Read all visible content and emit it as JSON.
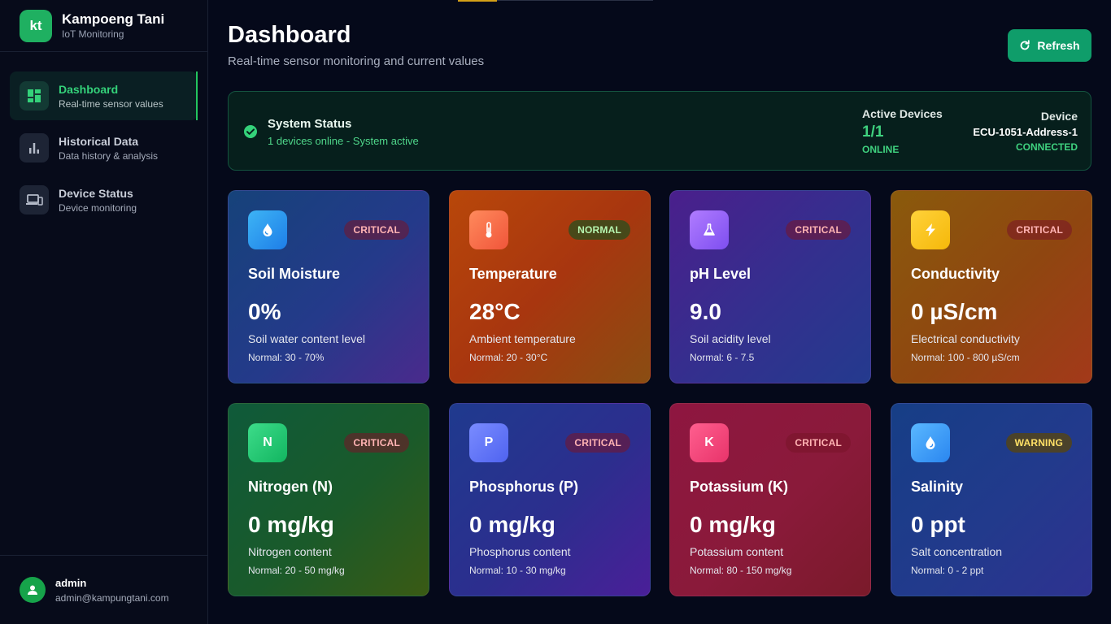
{
  "brand": {
    "logo_text": "kt",
    "title": "Kampoeng Tani",
    "subtitle": "IoT Monitoring"
  },
  "nav": [
    {
      "label": "Dashboard",
      "desc": "Real-time sensor values",
      "icon": "dashboard-grid-icon",
      "active": true
    },
    {
      "label": "Historical Data",
      "desc": "Data history & analysis",
      "icon": "bar-chart-icon",
      "active": false
    },
    {
      "label": "Device Status",
      "desc": "Device monitoring",
      "icon": "devices-icon",
      "active": false
    }
  ],
  "user": {
    "name": "admin",
    "email": "admin@kampungtani.com"
  },
  "page": {
    "title": "Dashboard",
    "subtitle": "Real-time sensor monitoring and current values",
    "refresh_label": "Refresh"
  },
  "status": {
    "title": "System Status",
    "subtitle": "1 devices online - System active",
    "active_label": "Active Devices",
    "active_value": "1/1",
    "active_state": "ONLINE",
    "device_label": "Device",
    "device_name": "ECU-1051-Address-1",
    "device_state": "CONNECTED"
  },
  "sensors": [
    {
      "name": "Soil Moisture",
      "value": "0%",
      "desc": "Soil water content level",
      "range": "Normal: 30 - 70%",
      "status": "CRITICAL",
      "icon": "water-drop-icon"
    },
    {
      "name": "Temperature",
      "value": "28°C",
      "desc": "Ambient temperature",
      "range": "Normal: 20 - 30°C",
      "status": "NORMAL",
      "icon": "thermometer-icon"
    },
    {
      "name": "pH Level",
      "value": "9.0",
      "desc": "Soil acidity level",
      "range": "Normal: 6 - 7.5",
      "status": "CRITICAL",
      "icon": "flask-icon"
    },
    {
      "name": "Conductivity",
      "value": "0 µS/cm",
      "desc": "Electrical conductivity",
      "range": "Normal: 100 - 800 µS/cm",
      "status": "CRITICAL",
      "icon": "lightning-icon"
    },
    {
      "name": "Nitrogen (N)",
      "value": "0 mg/kg",
      "desc": "Nitrogen content",
      "range": "Normal: 20 - 50 mg/kg",
      "status": "CRITICAL",
      "icon_text": "N"
    },
    {
      "name": "Phosphorus (P)",
      "value": "0 mg/kg",
      "desc": "Phosphorus content",
      "range": "Normal: 10 - 30 mg/kg",
      "status": "CRITICAL",
      "icon_text": "P"
    },
    {
      "name": "Potassium (K)",
      "value": "0 mg/kg",
      "desc": "Potassium content",
      "range": "Normal: 80 - 150 mg/kg",
      "status": "CRITICAL",
      "icon_text": "K"
    },
    {
      "name": "Salinity",
      "value": "0 ppt",
      "desc": "Salt concentration",
      "range": "Normal: 0 - 2 ppt",
      "status": "WARNING",
      "icon": "salt-drop-icon"
    }
  ]
}
